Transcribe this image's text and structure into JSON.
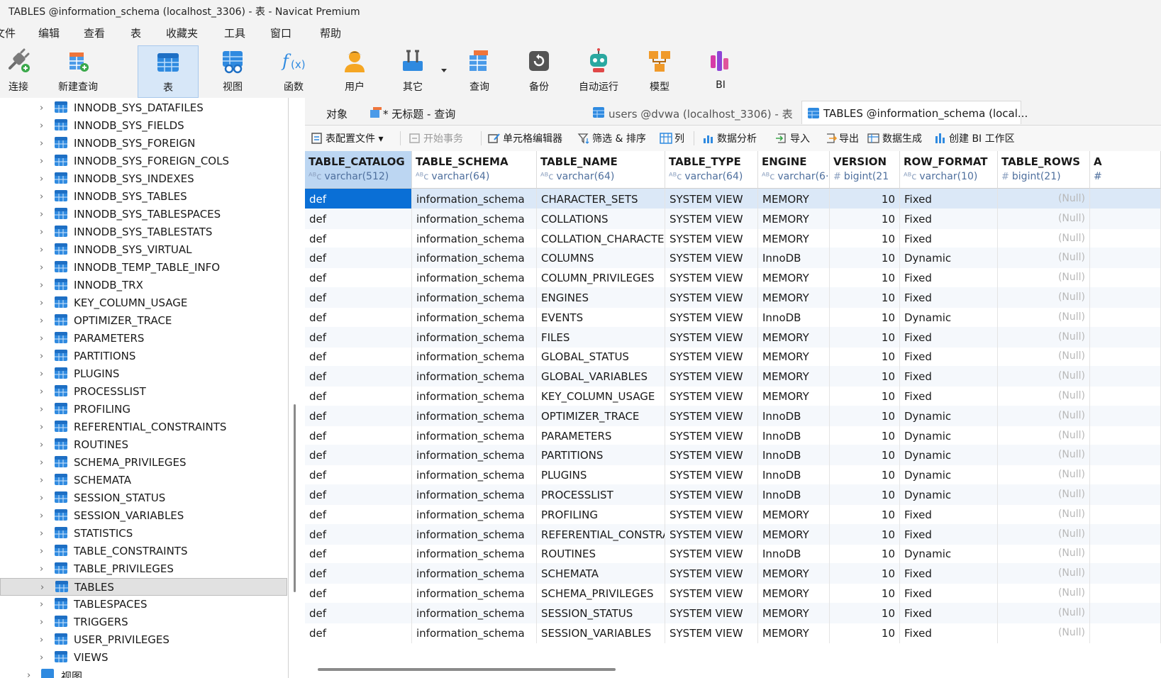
{
  "window": {
    "title": "TABLES @information_schema (localhost_3306) - 表 - Navicat Premium"
  },
  "menu": [
    "文件",
    "编辑",
    "查看",
    "表",
    "收藏夹",
    "工具",
    "窗口",
    "帮助"
  ],
  "toolbar": [
    {
      "label": "连接",
      "icon": "plug-icon"
    },
    {
      "label": "新建查询",
      "icon": "new-query-icon"
    },
    {
      "label": "表",
      "icon": "table-icon"
    },
    {
      "label": "视图",
      "icon": "view-icon"
    },
    {
      "label": "函数",
      "icon": "function-icon"
    },
    {
      "label": "用户",
      "icon": "user-icon"
    },
    {
      "label": "其它",
      "icon": "tools-icon"
    },
    {
      "label": "查询",
      "icon": "query-icon"
    },
    {
      "label": "备份",
      "icon": "backup-icon"
    },
    {
      "label": "自动运行",
      "icon": "robot-icon"
    },
    {
      "label": "模型",
      "icon": "model-icon"
    },
    {
      "label": "BI",
      "icon": "bi-icon"
    }
  ],
  "sidebar": {
    "items": [
      "INNODB_SYS_DATAFILES",
      "INNODB_SYS_FIELDS",
      "INNODB_SYS_FOREIGN",
      "INNODB_SYS_FOREIGN_COLS",
      "INNODB_SYS_INDEXES",
      "INNODB_SYS_TABLES",
      "INNODB_SYS_TABLESPACES",
      "INNODB_SYS_TABLESTATS",
      "INNODB_SYS_VIRTUAL",
      "INNODB_TEMP_TABLE_INFO",
      "INNODB_TRX",
      "KEY_COLUMN_USAGE",
      "OPTIMIZER_TRACE",
      "PARAMETERS",
      "PARTITIONS",
      "PLUGINS",
      "PROCESSLIST",
      "PROFILING",
      "REFERENTIAL_CONSTRAINTS",
      "ROUTINES",
      "SCHEMA_PRIVILEGES",
      "SCHEMATA",
      "SESSION_STATUS",
      "SESSION_VARIABLES",
      "STATISTICS",
      "TABLE_CONSTRAINTS",
      "TABLE_PRIVILEGES",
      "TABLES",
      "TABLESPACES",
      "TRIGGERS",
      "USER_PRIVILEGES",
      "VIEWS"
    ],
    "selected": "TABLES",
    "footer_label": "视图"
  },
  "tabs": [
    {
      "label": "对象"
    },
    {
      "label": "* 无标题 - 查询"
    },
    {
      "label": "users @dvwa (localhost_3306) - 表"
    },
    {
      "label": "TABLES @information_schema (local..."
    }
  ],
  "subtoolbar": [
    {
      "label": "表配置文件",
      "icon": "profile-icon",
      "disabled": false
    },
    {
      "label": "开始事务",
      "icon": "transaction-icon",
      "disabled": true
    },
    {
      "label": "单元格编辑器",
      "icon": "cell-editor-icon",
      "disabled": false
    },
    {
      "label": "筛选 & 排序",
      "icon": "filter-icon",
      "disabled": false
    },
    {
      "label": "列",
      "icon": "columns-icon",
      "disabled": false
    },
    {
      "label": "数据分析",
      "icon": "analysis-icon",
      "disabled": false
    },
    {
      "label": "导入",
      "icon": "import-icon",
      "disabled": false
    },
    {
      "label": "导出",
      "icon": "export-icon",
      "disabled": false
    },
    {
      "label": "数据生成",
      "icon": "datagen-icon",
      "disabled": false
    },
    {
      "label": "创建 BI 工作区",
      "icon": "bi-workspace-icon",
      "disabled": false
    }
  ],
  "table": {
    "columns": [
      {
        "name": "TABLE_CATALOG",
        "type": "varchar(512)",
        "kind": "text"
      },
      {
        "name": "TABLE_SCHEMA",
        "type": "varchar(64)",
        "kind": "text"
      },
      {
        "name": "TABLE_NAME",
        "type": "varchar(64)",
        "kind": "text"
      },
      {
        "name": "TABLE_TYPE",
        "type": "varchar(64)",
        "kind": "text"
      },
      {
        "name": "ENGINE",
        "type": "varchar(6·",
        "kind": "text"
      },
      {
        "name": "VERSION",
        "type": "bigint(21",
        "kind": "num"
      },
      {
        "name": "ROW_FORMAT",
        "type": "varchar(10)",
        "kind": "text"
      },
      {
        "name": "TABLE_ROWS",
        "type": "bigint(21)",
        "kind": "num"
      },
      {
        "name": "A",
        "type": "#",
        "kind": "text"
      }
    ],
    "null_text": "(Null)",
    "rows": [
      [
        "def",
        "information_schema",
        "CHARACTER_SETS",
        "SYSTEM VIEW",
        "MEMORY",
        "10",
        "Fixed"
      ],
      [
        "def",
        "information_schema",
        "COLLATIONS",
        "SYSTEM VIEW",
        "MEMORY",
        "10",
        "Fixed"
      ],
      [
        "def",
        "information_schema",
        "COLLATION_CHARACTE",
        "SYSTEM VIEW",
        "MEMORY",
        "10",
        "Fixed"
      ],
      [
        "def",
        "information_schema",
        "COLUMNS",
        "SYSTEM VIEW",
        "InnoDB",
        "10",
        "Dynamic"
      ],
      [
        "def",
        "information_schema",
        "COLUMN_PRIVILEGES",
        "SYSTEM VIEW",
        "MEMORY",
        "10",
        "Fixed"
      ],
      [
        "def",
        "information_schema",
        "ENGINES",
        "SYSTEM VIEW",
        "MEMORY",
        "10",
        "Fixed"
      ],
      [
        "def",
        "information_schema",
        "EVENTS",
        "SYSTEM VIEW",
        "InnoDB",
        "10",
        "Dynamic"
      ],
      [
        "def",
        "information_schema",
        "FILES",
        "SYSTEM VIEW",
        "MEMORY",
        "10",
        "Fixed"
      ],
      [
        "def",
        "information_schema",
        "GLOBAL_STATUS",
        "SYSTEM VIEW",
        "MEMORY",
        "10",
        "Fixed"
      ],
      [
        "def",
        "information_schema",
        "GLOBAL_VARIABLES",
        "SYSTEM VIEW",
        "MEMORY",
        "10",
        "Fixed"
      ],
      [
        "def",
        "information_schema",
        "KEY_COLUMN_USAGE",
        "SYSTEM VIEW",
        "MEMORY",
        "10",
        "Fixed"
      ],
      [
        "def",
        "information_schema",
        "OPTIMIZER_TRACE",
        "SYSTEM VIEW",
        "InnoDB",
        "10",
        "Dynamic"
      ],
      [
        "def",
        "information_schema",
        "PARAMETERS",
        "SYSTEM VIEW",
        "InnoDB",
        "10",
        "Dynamic"
      ],
      [
        "def",
        "information_schema",
        "PARTITIONS",
        "SYSTEM VIEW",
        "InnoDB",
        "10",
        "Dynamic"
      ],
      [
        "def",
        "information_schema",
        "PLUGINS",
        "SYSTEM VIEW",
        "InnoDB",
        "10",
        "Dynamic"
      ],
      [
        "def",
        "information_schema",
        "PROCESSLIST",
        "SYSTEM VIEW",
        "InnoDB",
        "10",
        "Dynamic"
      ],
      [
        "def",
        "information_schema",
        "PROFILING",
        "SYSTEM VIEW",
        "MEMORY",
        "10",
        "Fixed"
      ],
      [
        "def",
        "information_schema",
        "REFERENTIAL_CONSTRA",
        "SYSTEM VIEW",
        "MEMORY",
        "10",
        "Fixed"
      ],
      [
        "def",
        "information_schema",
        "ROUTINES",
        "SYSTEM VIEW",
        "InnoDB",
        "10",
        "Dynamic"
      ],
      [
        "def",
        "information_schema",
        "SCHEMATA",
        "SYSTEM VIEW",
        "MEMORY",
        "10",
        "Fixed"
      ],
      [
        "def",
        "information_schema",
        "SCHEMA_PRIVILEGES",
        "SYSTEM VIEW",
        "MEMORY",
        "10",
        "Fixed"
      ],
      [
        "def",
        "information_schema",
        "SESSION_STATUS",
        "SYSTEM VIEW",
        "MEMORY",
        "10",
        "Fixed"
      ],
      [
        "def",
        "information_schema",
        "SESSION_VARIABLES",
        "SYSTEM VIEW",
        "MEMORY",
        "10",
        "Fixed"
      ]
    ]
  },
  "colors": {
    "accent": "#0a6fd6",
    "header_selected": "#bcd6f2",
    "row_highlight": "#dbe8f7"
  }
}
